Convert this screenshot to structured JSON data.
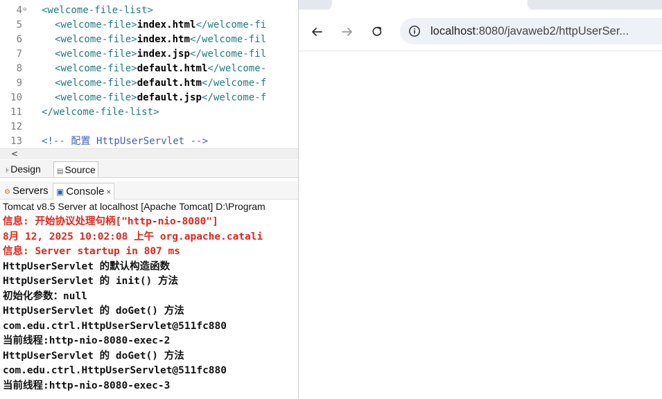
{
  "editor": {
    "lines": [
      {
        "num": "4",
        "fold": "⊖",
        "parts": [
          {
            "t": "<welcome-file-list>",
            "c": "tag"
          }
        ],
        "indent": 0
      },
      {
        "num": "5",
        "parts": [
          {
            "t": "<welcome-file>",
            "c": "tag"
          },
          {
            "t": "index.html",
            "c": "txt"
          },
          {
            "t": "</welcome-fi",
            "c": "tag"
          }
        ],
        "indent": 1
      },
      {
        "num": "6",
        "parts": [
          {
            "t": "<welcome-file>",
            "c": "tag"
          },
          {
            "t": "index.htm",
            "c": "txt"
          },
          {
            "t": "</welcome-fil",
            "c": "tag"
          }
        ],
        "indent": 1
      },
      {
        "num": "7",
        "parts": [
          {
            "t": "<welcome-file>",
            "c": "tag"
          },
          {
            "t": "index.jsp",
            "c": "txt"
          },
          {
            "t": "</welcome-fil",
            "c": "tag"
          }
        ],
        "indent": 1
      },
      {
        "num": "8",
        "parts": [
          {
            "t": "<welcome-file>",
            "c": "tag"
          },
          {
            "t": "default.html",
            "c": "txt"
          },
          {
            "t": "</welcome-",
            "c": "tag"
          }
        ],
        "indent": 1
      },
      {
        "num": "9",
        "parts": [
          {
            "t": "<welcome-file>",
            "c": "tag"
          },
          {
            "t": "default.htm",
            "c": "txt"
          },
          {
            "t": "</welcome-f",
            "c": "tag"
          }
        ],
        "indent": 1
      },
      {
        "num": "10",
        "parts": [
          {
            "t": "<welcome-file>",
            "c": "tag"
          },
          {
            "t": "default.jsp",
            "c": "txt"
          },
          {
            "t": "</welcome-f",
            "c": "tag"
          }
        ],
        "indent": 1
      },
      {
        "num": "11",
        "parts": [
          {
            "t": "</welcome-file-list>",
            "c": "tag"
          }
        ],
        "indent": 0
      },
      {
        "num": "12",
        "parts": [],
        "indent": 0
      },
      {
        "num": "13",
        "parts": [
          {
            "t": "<!-- 配置 HttpUserServlet -->",
            "c": "cmt"
          }
        ],
        "indent": 0
      }
    ],
    "scroll_left": "<"
  },
  "editor_tabs": {
    "design": {
      "icon": "design-icon",
      "label": "Design"
    },
    "source": {
      "icon": "source-icon",
      "label": "Source"
    }
  },
  "views": {
    "servers": {
      "icon": "servers-icon",
      "label": "Servers"
    },
    "console": {
      "icon": "console-icon",
      "label": "Console",
      "close": "×"
    }
  },
  "console": {
    "header": "Tomcat v8.5 Server at localhost [Apache Tomcat] D:\\Program",
    "lines": [
      {
        "text": "信息: 开始协议处理句柄[\"http-nio-8080\"]",
        "color": "red"
      },
      {
        "text": "8月 12, 2025 10:02:08 上午 org.apache.catali",
        "color": "red"
      },
      {
        "text": "信息: Server startup in 807 ms",
        "color": "red"
      },
      {
        "text": "HttpUserServlet 的默认构造函数",
        "color": "black"
      },
      {
        "text": "HttpUserServlet 的 init() 方法",
        "color": "black"
      },
      {
        "text": "初始化参数：null",
        "color": "black"
      },
      {
        "text": "HttpUserServlet 的 doGet() 方法",
        "color": "black"
      },
      {
        "text": "com.edu.ctrl.HttpUserServlet@511fc880",
        "color": "black"
      },
      {
        "text": "当前线程:http-nio-8080-exec-2",
        "color": "black"
      },
      {
        "text": "HttpUserServlet 的 doGet() 方法",
        "color": "black"
      },
      {
        "text": "com.edu.ctrl.HttpUserServlet@511fc880",
        "color": "black"
      },
      {
        "text": "当前线程:http-nio-8080-exec-3",
        "color": "black"
      }
    ]
  },
  "browser": {
    "back_icon": "back-arrow-icon",
    "forward_icon": "forward-arrow-icon",
    "reload_icon": "reload-icon",
    "info_icon": "info-icon",
    "url_host": "localhost",
    "url_rest": ":8080/javaweb2/httpUserSer...",
    "colors": {
      "omnibox_bg": "#eef1f6",
      "tag": "#1f7a7e",
      "comment": "#3f5fbf",
      "console_red": "#e1261c"
    }
  }
}
